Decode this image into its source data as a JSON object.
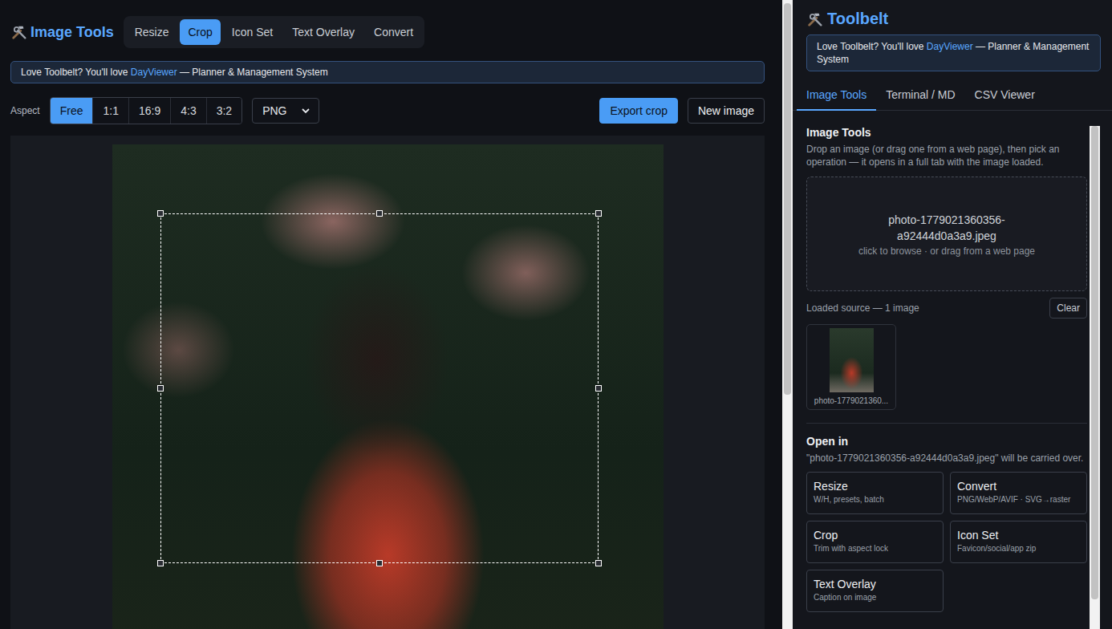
{
  "left": {
    "app_title": "Image Tools",
    "tabs": [
      {
        "label": "Resize",
        "selected": false
      },
      {
        "label": "Crop",
        "selected": true
      },
      {
        "label": "Icon Set",
        "selected": false
      },
      {
        "label": "Text Overlay",
        "selected": false
      },
      {
        "label": "Convert",
        "selected": false
      }
    ],
    "banner": {
      "prefix": "Love Toolbelt? You'll love ",
      "link": "DayViewer",
      "suffix": " — Planner & Management System"
    },
    "aspect_label": "Aspect",
    "aspects": [
      {
        "label": "Free",
        "selected": true
      },
      {
        "label": "1:1",
        "selected": false
      },
      {
        "label": "16:9",
        "selected": false
      },
      {
        "label": "4:3",
        "selected": false
      },
      {
        "label": "3:2",
        "selected": false
      }
    ],
    "format": "PNG",
    "export_button": "Export crop",
    "new_button": "New image"
  },
  "right": {
    "title": "Toolbelt",
    "banner": {
      "prefix": "Love Toolbelt? You'll love ",
      "link": "DayViewer",
      "suffix": " — Planner & Management System"
    },
    "tabs": [
      {
        "label": "Image Tools",
        "selected": true
      },
      {
        "label": "Terminal / MD",
        "selected": false
      },
      {
        "label": "CSV Viewer",
        "selected": false
      }
    ],
    "section_title": "Image Tools",
    "description": "Drop an image (or drag one from a web page), then pick an operation — it opens in a full tab with the image loaded.",
    "dropzone": {
      "filename": "photo-1779021360356-a92444d0a3a9.jpeg",
      "hint": "click to browse · or drag from a web page"
    },
    "loaded_label": "Loaded source — 1 image",
    "clear_button": "Clear",
    "thumbnails": [
      {
        "caption": "photo-1779021360..."
      }
    ],
    "open_in_title": "Open in",
    "carry_note": "\"photo-1779021360356-a92444d0a3a9.jpeg\" will be carried over.",
    "operations": [
      {
        "title": "Resize",
        "subtitle": "W/H, presets, batch"
      },
      {
        "title": "Convert",
        "subtitle": "PNG/WebP/AVIF · SVG→raster"
      },
      {
        "title": "Crop",
        "subtitle": "Trim with aspect lock"
      },
      {
        "title": "Icon Set",
        "subtitle": "Favicon/social/app zip"
      },
      {
        "title": "Text Overlay",
        "subtitle": "Caption on image"
      }
    ]
  }
}
